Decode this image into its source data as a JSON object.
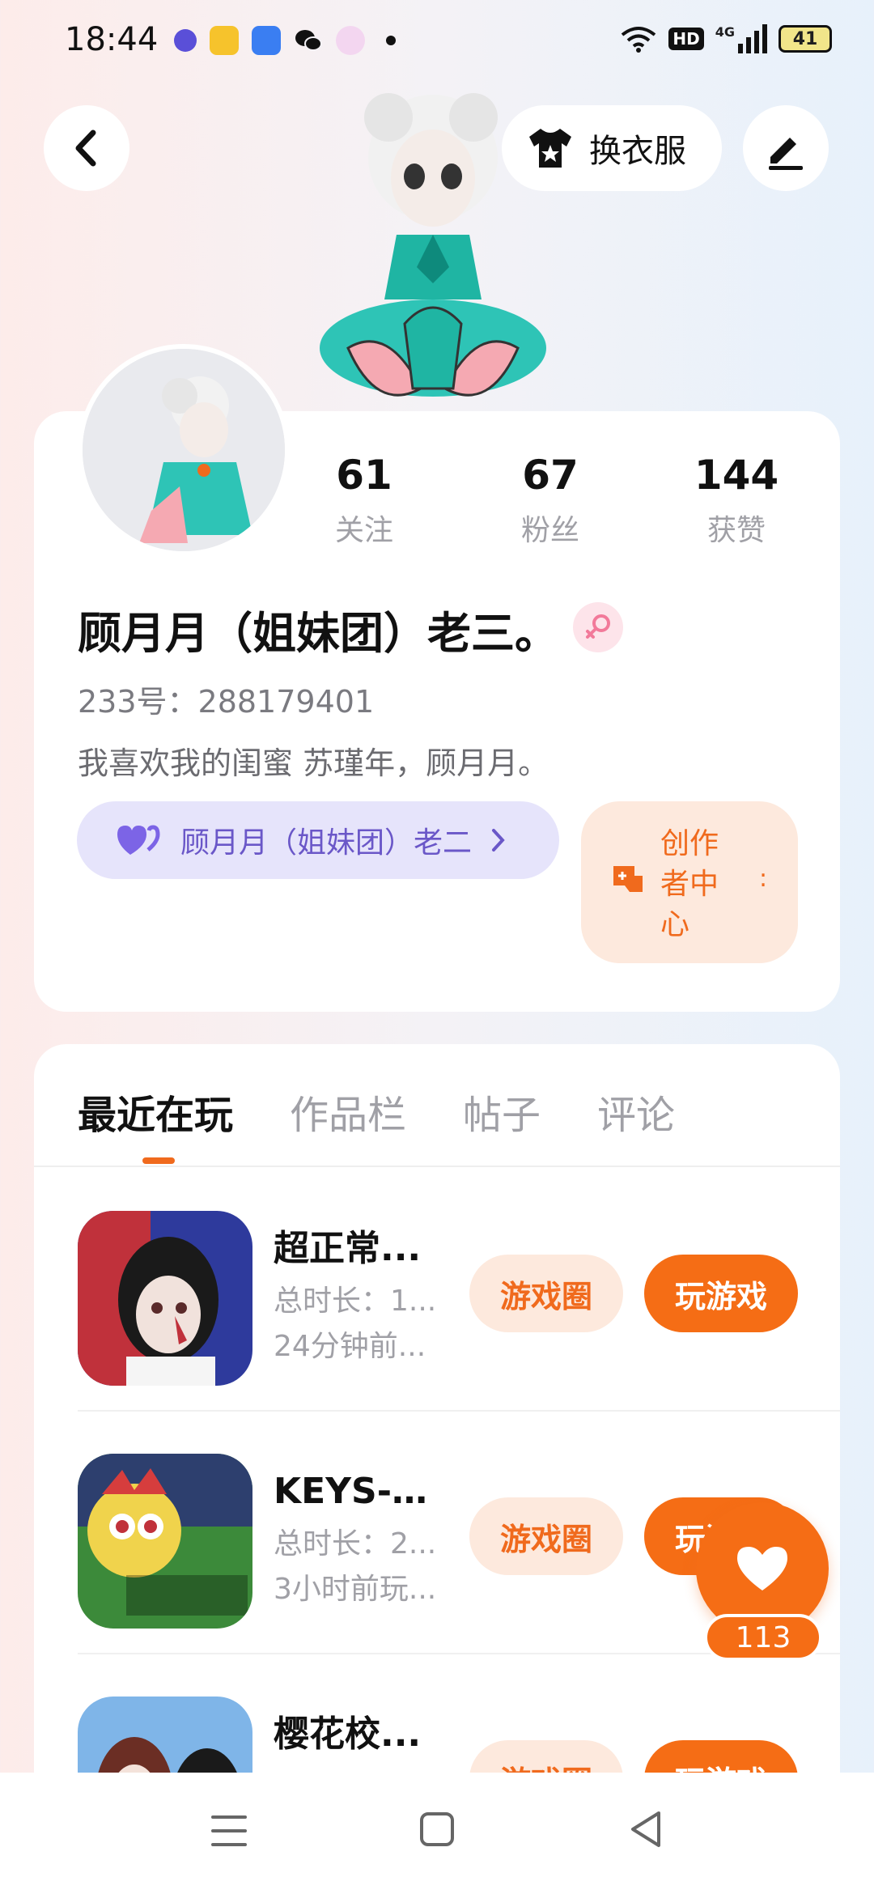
{
  "status_bar": {
    "time": "18:44",
    "network": "4G",
    "hd": "HD",
    "battery": "41"
  },
  "header": {
    "dress_label": "换衣服"
  },
  "stats": [
    {
      "value": "61",
      "label": "关注"
    },
    {
      "value": "67",
      "label": "粉丝"
    },
    {
      "value": "144",
      "label": "获赞"
    }
  ],
  "profile": {
    "username": "顾月月（姐妹团）老三。",
    "uid": "233号：288179401",
    "bio": "我喜欢我的闺蜜 苏瑾年，顾月月。",
    "bestie_label": "顾月月（姐妹团）老二",
    "creator_label": "创作者中心"
  },
  "tabs": [
    "最近在玩",
    "作品栏",
    "帖子",
    "评论"
  ],
  "games": [
    {
      "title": "超正常...",
      "duration": "总时长：1...",
      "last_played": "24分钟前...",
      "circle_label": "游戏圈",
      "play_label": "玩游戏"
    },
    {
      "title": "KEYS-极...",
      "duration": "总时长：2...",
      "last_played": "3小时前玩...",
      "circle_label": "游戏圈",
      "play_label": "玩游戏"
    },
    {
      "title": "樱花校...",
      "duration": "",
      "last_played": "",
      "circle_label": "游戏圈",
      "play_label": "玩游戏"
    }
  ],
  "like": {
    "count": "113"
  },
  "colors": {
    "accent": "#f56d15",
    "accent_soft": "#fde9dd",
    "purple": "#6a57c8"
  }
}
